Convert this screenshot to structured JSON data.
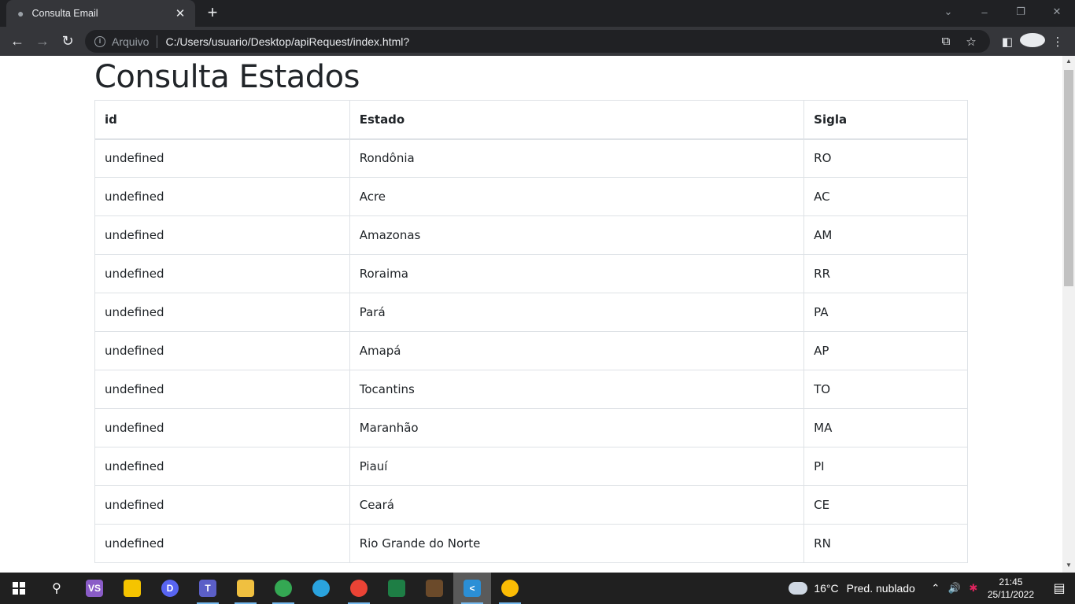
{
  "browser": {
    "tab_title": "Consulta Email",
    "address_label": "Arquivo",
    "url": "C:/Users/usuario/Desktop/apiRequest/index.html?"
  },
  "page": {
    "title": "Consulta Estados",
    "table": {
      "headers": [
        "id",
        "Estado",
        "Sigla"
      ],
      "rows": [
        [
          "undefined",
          "Rondônia",
          "RO"
        ],
        [
          "undefined",
          "Acre",
          "AC"
        ],
        [
          "undefined",
          "Amazonas",
          "AM"
        ],
        [
          "undefined",
          "Roraima",
          "RR"
        ],
        [
          "undefined",
          "Pará",
          "PA"
        ],
        [
          "undefined",
          "Amapá",
          "AP"
        ],
        [
          "undefined",
          "Tocantins",
          "TO"
        ],
        [
          "undefined",
          "Maranhão",
          "MA"
        ],
        [
          "undefined",
          "Piauí",
          "PI"
        ],
        [
          "undefined",
          "Ceará",
          "CE"
        ],
        [
          "undefined",
          "Rio Grande do Norte",
          "RN"
        ]
      ]
    }
  },
  "taskbar": {
    "apps": [
      {
        "name": "visual-studio",
        "color": "#8a5cc7",
        "glyph": "VS"
      },
      {
        "name": "sticky-notes",
        "color": "#f5c400",
        "glyph": ""
      },
      {
        "name": "discord",
        "color": "#5865f2",
        "glyph": "D"
      },
      {
        "name": "teams",
        "color": "#5b5fc7",
        "glyph": "T"
      },
      {
        "name": "file-explorer",
        "color": "#f0c040",
        "glyph": ""
      },
      {
        "name": "chrome-profile",
        "color": "#34a853",
        "glyph": ""
      },
      {
        "name": "telegram",
        "color": "#2aa3de",
        "glyph": ""
      },
      {
        "name": "chrome-profile-2",
        "color": "#ea4335",
        "glyph": ""
      },
      {
        "name": "spreadsheet-app",
        "color": "#1e7e45",
        "glyph": ""
      },
      {
        "name": "game-app",
        "color": "#6b4a2a",
        "glyph": ""
      },
      {
        "name": "vscode",
        "color": "#2b8fd6",
        "glyph": "<"
      },
      {
        "name": "chrome",
        "color": "#fbbc04",
        "glyph": ""
      }
    ],
    "weather_temp": "16°C",
    "weather_desc": "Pred. nublado",
    "time": "21:45",
    "date": "25/11/2022"
  }
}
